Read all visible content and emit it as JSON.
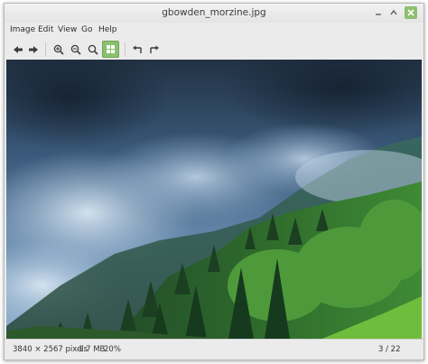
{
  "window": {
    "title": "gbowden_morzine.jpg"
  },
  "menu": {
    "items": [
      "Image",
      "Edit",
      "View",
      "Go",
      "Help"
    ]
  },
  "toolbar": {
    "buttons": [
      {
        "name": "back-icon"
      },
      {
        "name": "forward-icon"
      },
      {
        "name": "zoom-in-icon"
      },
      {
        "name": "zoom-out-icon"
      },
      {
        "name": "zoom-normal-icon"
      },
      {
        "name": "fit-to-window-icon",
        "active": true
      },
      {
        "name": "rotate-left-icon"
      },
      {
        "name": "rotate-right-icon"
      }
    ],
    "active_color": "#8cbf6e"
  },
  "image": {
    "description_colors": {
      "sky": "#3f5f82",
      "forest": "#2e6b2c",
      "grass": "#6fbd3d"
    }
  },
  "status": {
    "dimensions": "3840 × 2567 pixels",
    "size": "1.7 MB",
    "zoom": "20%",
    "position": "3 / 22"
  }
}
